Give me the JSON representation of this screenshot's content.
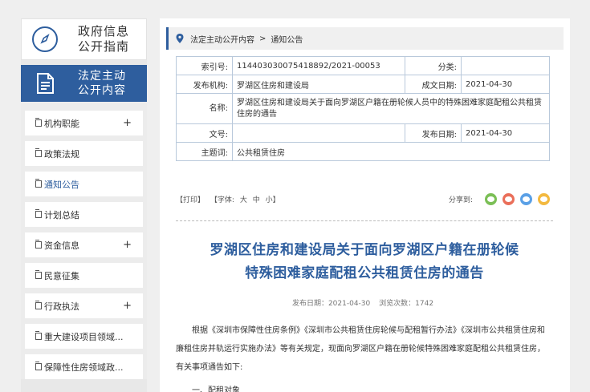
{
  "sidebar": {
    "guide_title_1": "政府信息",
    "guide_title_2": "公开指南",
    "law_title_1": "法定主动",
    "law_title_2": "公开内容",
    "items": [
      {
        "label": "机构职能",
        "expand": "+"
      },
      {
        "label": "政策法规",
        "expand": ""
      },
      {
        "label": "通知公告",
        "expand": ""
      },
      {
        "label": "计划总结",
        "expand": ""
      },
      {
        "label": "资金信息",
        "expand": "+"
      },
      {
        "label": "民意征集",
        "expand": ""
      },
      {
        "label": "行政执法",
        "expand": "+"
      },
      {
        "label": "重大建设项目领域...",
        "expand": ""
      },
      {
        "label": "保障性住房领域政...",
        "expand": ""
      }
    ]
  },
  "breadcrumb": {
    "level1": "法定主动公开内容",
    "separator": ">",
    "level2": "通知公告"
  },
  "meta": {
    "index_label": "索引号:",
    "index_value": "114403030075418892/2021-00053",
    "category_label": "分类:",
    "category_value": "",
    "publisher_label": "发布机构:",
    "publisher_value": "罗湖区住房和建设局",
    "created_label": "成文日期:",
    "created_value": "2021-04-30",
    "name_label": "名称:",
    "name_value": "罗湖区住房和建设局关于面向罗湖区户籍在册轮候人员中的特殊困难家庭配租公共租赁住房的通告",
    "docno_label": "文号:",
    "docno_value": "",
    "published_label": "发布日期:",
    "published_value": "2021-04-30",
    "topic_label": "主题词:",
    "topic_value": "公共租赁住房"
  },
  "tools": {
    "print": "【打印】",
    "font_label": "【字体:",
    "font_large": "大",
    "font_medium": "中",
    "font_small": "小】",
    "share_label": "分享到:"
  },
  "article": {
    "title": "罗湖区住房和建设局关于面向罗湖区户籍在册轮候特殊困难家庭配租公共租赁住房的通告",
    "title_line1": "罗湖区住房和建设局关于面向罗湖区户籍在册轮候",
    "title_line2": "特殊困难家庭配租公共租赁住房的通告",
    "date_text": "发布日期：2021-04-30",
    "views_text": "浏览次数：1742",
    "paragraph": "根据《深圳市保障性住房条例》《深圳市公共租赁住房轮候与配租暂行办法》《深圳市公共租赁住房和廉租住房并轨运行实施办法》等有关规定，现面向罗湖区户籍在册轮候特殊困难家庭配租公共租赁住房，有关事项通告如下:",
    "next_heading": "一、配租对象"
  },
  "colors": {
    "accent": "#2e5e9e",
    "share_wechat": "#7bbf56",
    "share_weibo": "#ea6f5a",
    "share_qq": "#5aa0e6",
    "share_qzone": "#f3b93f"
  },
  "icons": {
    "guide": "compass-icon",
    "law": "document-icon",
    "crumb": "location-pin-icon",
    "menu": "document-copy-icon"
  }
}
